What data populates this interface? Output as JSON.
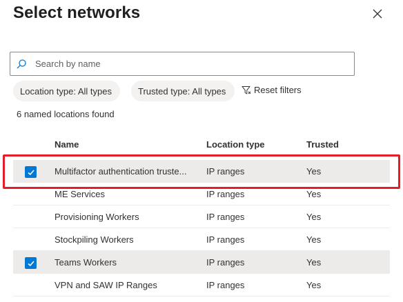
{
  "panel": {
    "title": "Select networks"
  },
  "search": {
    "placeholder": "Search by name",
    "value": ""
  },
  "filters": {
    "location_type": "Location type: All types",
    "trusted_type": "Trusted type: All types",
    "reset_label": "Reset filters"
  },
  "results": {
    "count_text": "6 named locations found"
  },
  "table": {
    "columns": [
      "Name",
      "Location type",
      "Trusted"
    ],
    "rows": [
      {
        "name": "Multifactor authentication truste...",
        "location_type": "IP ranges",
        "trusted": "Yes",
        "checked": true
      },
      {
        "name": "ME Services",
        "location_type": "IP ranges",
        "trusted": "Yes",
        "checked": false
      },
      {
        "name": "Provisioning Workers",
        "location_type": "IP ranges",
        "trusted": "Yes",
        "checked": false
      },
      {
        "name": "Stockpiling Workers",
        "location_type": "IP ranges",
        "trusted": "Yes",
        "checked": false
      },
      {
        "name": "Teams Workers",
        "location_type": "IP ranges",
        "trusted": "Yes",
        "checked": true
      },
      {
        "name": "VPN and SAW IP Ranges",
        "location_type": "IP ranges",
        "trusted": "Yes",
        "checked": false
      }
    ]
  },
  "icons": {
    "close": "close-icon",
    "search": "search-icon",
    "filter": "filter-icon",
    "checkbox": "checkmark-icon"
  },
  "colors": {
    "accent": "#0078d4",
    "highlight_border": "#e41e26",
    "selected_row": "#edebe9",
    "pill_background": "#f3f2f1"
  }
}
